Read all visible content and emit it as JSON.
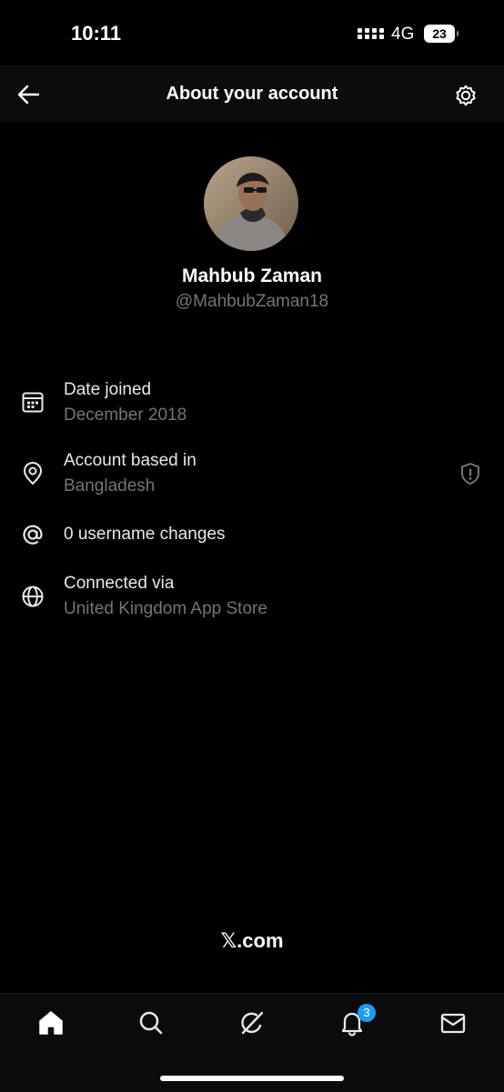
{
  "status_bar": {
    "time": "10:11",
    "network": "4G",
    "battery_level": "23"
  },
  "header": {
    "title": "About your account",
    "back_icon": "arrow-left-icon",
    "settings_icon": "gear-icon"
  },
  "profile": {
    "display_name": "Mahbub Zaman",
    "handle": "@MahbubZaman18"
  },
  "info_rows": [
    {
      "icon": "calendar-icon",
      "label": "Date joined",
      "value": "December 2018"
    },
    {
      "icon": "location-pin-icon",
      "label": "Account based in",
      "value": "Bangladesh",
      "trailing_icon": "shield-alert-icon"
    },
    {
      "icon": "at-sign-icon",
      "label": "0 username changes",
      "value": ""
    },
    {
      "icon": "globe-icon",
      "label": "Connected via",
      "value": "United Kingdom App Store"
    }
  ],
  "footer": {
    "logo_text": "𝕏.com"
  },
  "bottom_nav": {
    "items": [
      "home-icon",
      "search-icon",
      "grok-icon",
      "bell-icon",
      "mail-icon"
    ],
    "notification_count": "3"
  },
  "colors": {
    "background": "#000000",
    "muted_text": "#71767b",
    "badge": "#1d9bf0"
  }
}
